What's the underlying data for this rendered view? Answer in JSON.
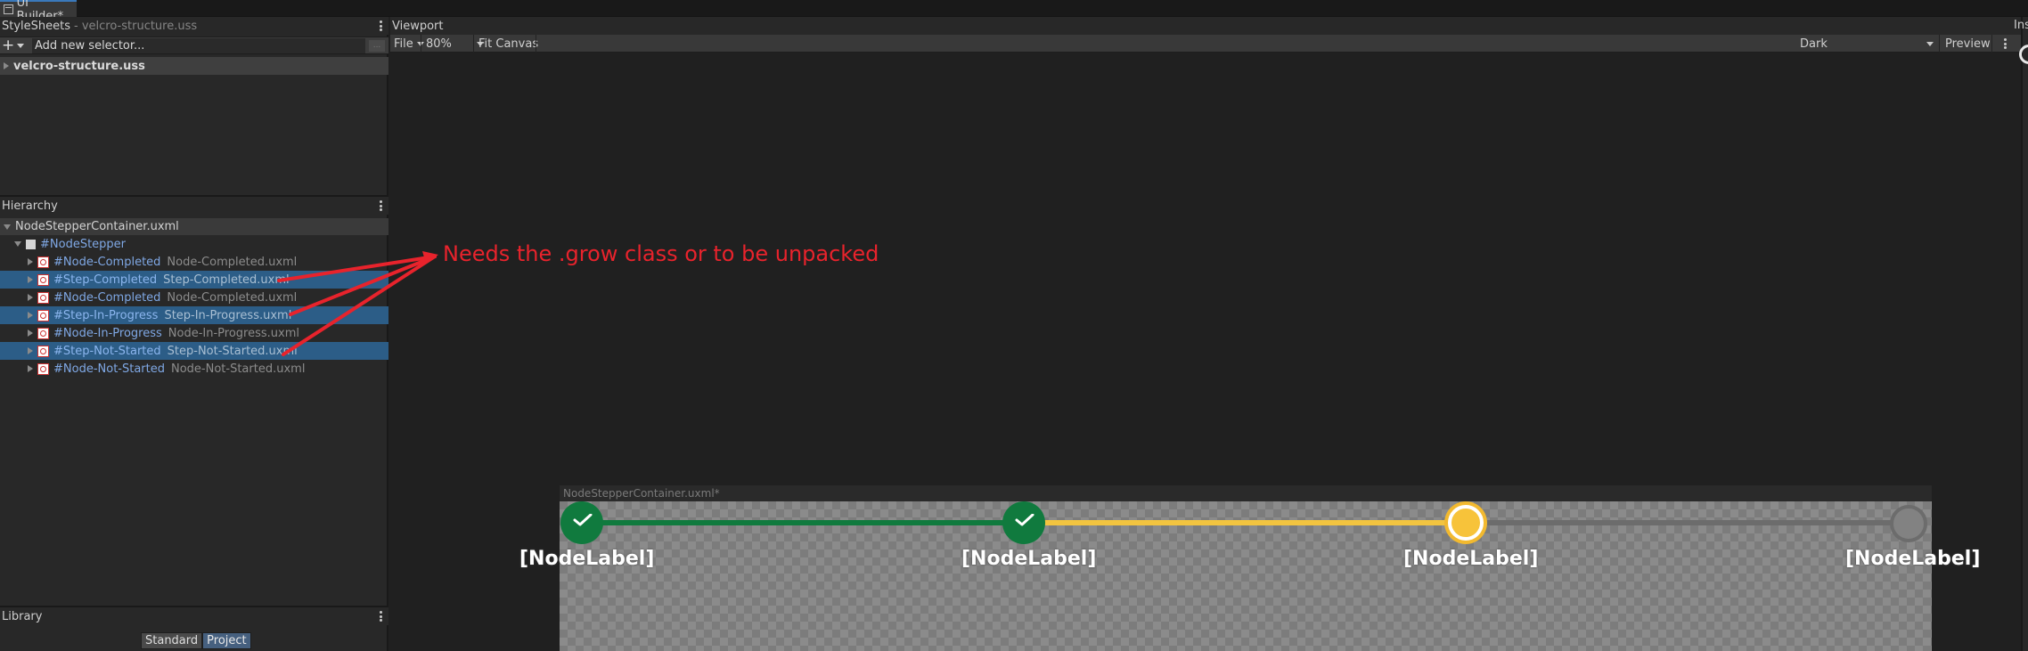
{
  "window_tab": {
    "title": "UI Builder*"
  },
  "stylesheets": {
    "title": "StyleSheets",
    "subtitle": "- velcro-structure.uss",
    "add_selector_placeholder": "Add new selector...",
    "plus_label": "+",
    "more_label": "...",
    "items": [
      {
        "label": "velcro-structure.uss"
      }
    ]
  },
  "hierarchy": {
    "title": "Hierarchy",
    "root_document": "NodeStepperContainer.uxml",
    "root_element": "#NodeStepper",
    "items": [
      {
        "name": "#Node-Completed",
        "file": "Node-Completed.uxml",
        "selected": false
      },
      {
        "name": "#Step-Completed",
        "file": "Step-Completed.uxml",
        "selected": true
      },
      {
        "name": "#Node-Completed",
        "file": "Node-Completed.uxml",
        "selected": false
      },
      {
        "name": "#Step-In-Progress",
        "file": "Step-In-Progress.uxml",
        "selected": true
      },
      {
        "name": "#Node-In-Progress",
        "file": "Node-In-Progress.uxml",
        "selected": false
      },
      {
        "name": "#Step-Not-Started",
        "file": "Step-Not-Started.uxml",
        "selected": true
      },
      {
        "name": "#Node-Not-Started",
        "file": "Node-Not-Started.uxml",
        "selected": false
      }
    ]
  },
  "library": {
    "title": "Library",
    "tabs": [
      "Standard",
      "Project"
    ],
    "active_tab": "Project"
  },
  "viewport": {
    "title": "Viewport",
    "toolbar": {
      "file_label": "File",
      "zoom": "80%",
      "fit_canvas": "Fit Canvas",
      "theme": "Dark",
      "preview": "Preview"
    },
    "document_title": "NodeStepperContainer.uxml*",
    "node_labels": [
      "[NodeLabel]",
      "[NodeLabel]",
      "[NodeLabel]",
      "[NodeLabel]"
    ],
    "node_states": [
      "completed",
      "completed",
      "in-progress",
      "not-started"
    ]
  },
  "inspector": {
    "title": "Inspector"
  },
  "annotation": {
    "text": "Needs the .grow class or to be unpacked"
  },
  "colors": {
    "accent_blue": "#3a79bb",
    "selection": "#2c5d87",
    "completed_green": "#107a3e",
    "progress_yellow": "#f7c33a",
    "not_started_gray": "#6c6c6c",
    "annotation_red": "#e8232c"
  }
}
